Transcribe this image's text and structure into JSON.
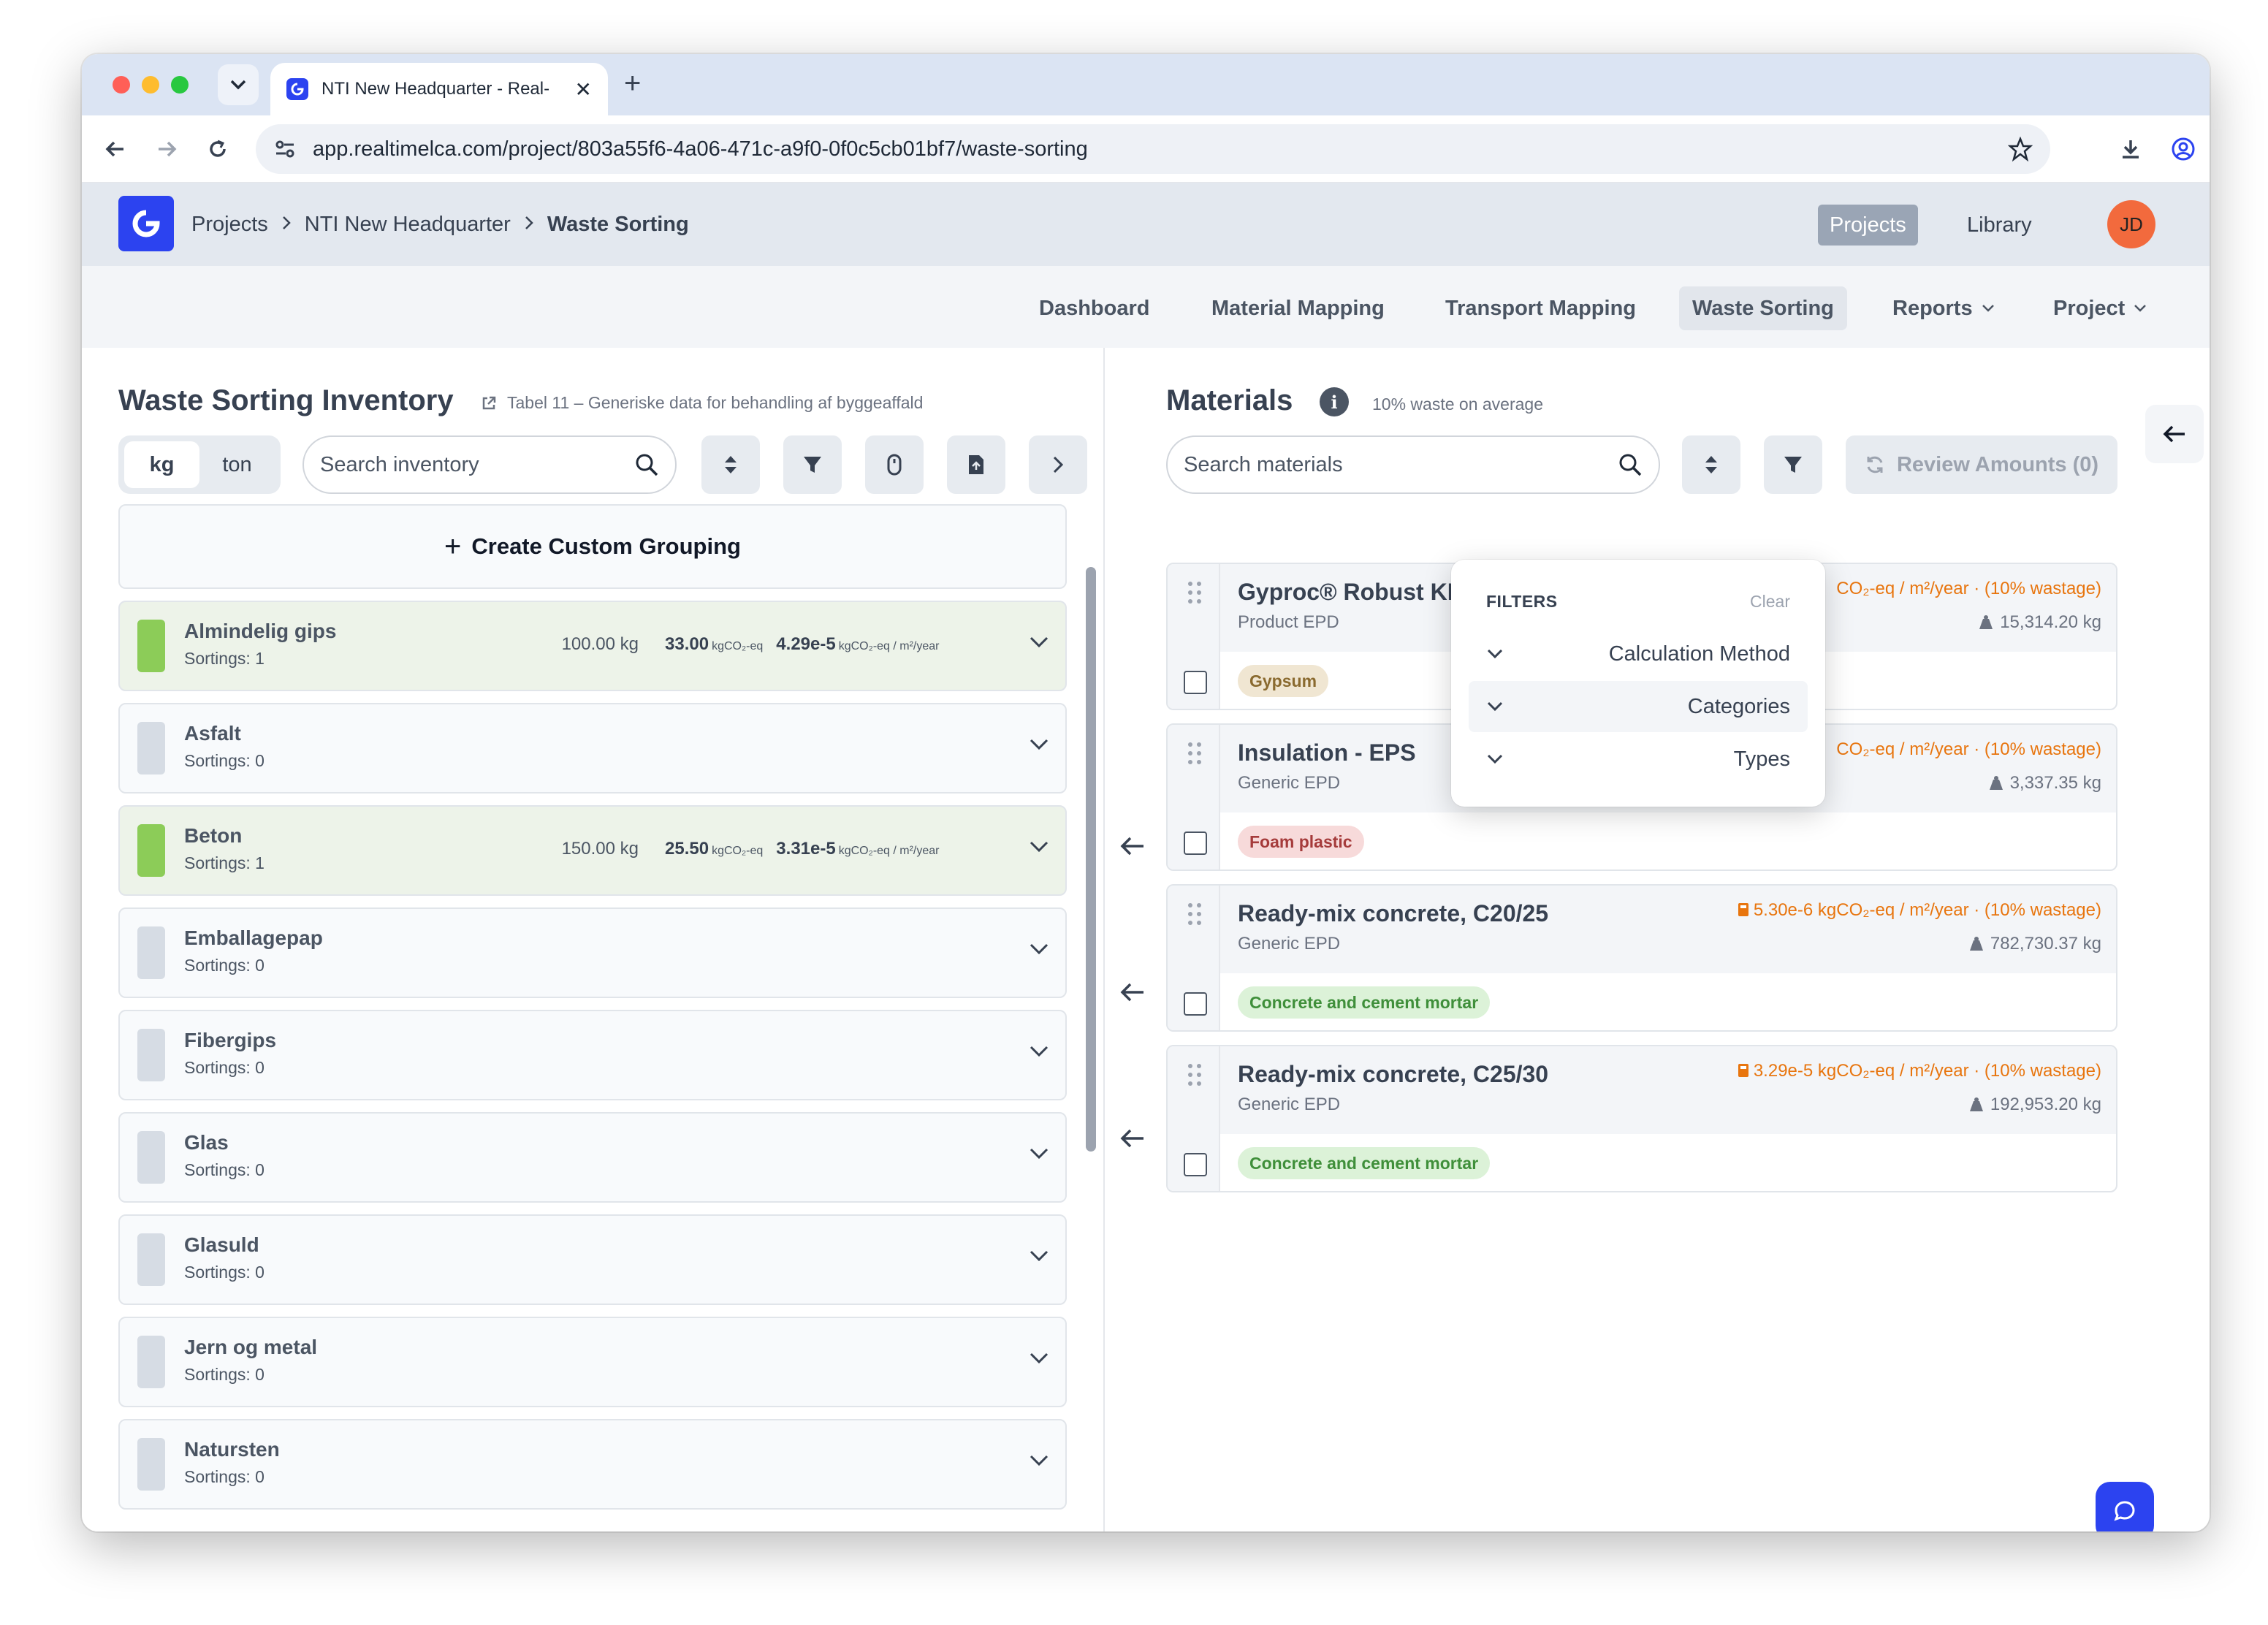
{
  "browser": {
    "tab_title": "NTI New Headquarter - Real-",
    "url": "app.realtimelca.com/project/803a55f6-4a06-471c-a9f0-0f0c5cb01bf7/waste-sorting",
    "colors": {
      "red": "#ff5f57",
      "yellow": "#febc2e",
      "green": "#28c840"
    }
  },
  "header": {
    "breadcrumb": [
      "Projects",
      "NTI New Headquarter",
      "Waste Sorting"
    ],
    "projects_btn": "Projects",
    "library_btn": "Library",
    "avatar_initials": "JD"
  },
  "subnav": {
    "items": [
      "Dashboard",
      "Material Mapping",
      "Transport Mapping",
      "Waste Sorting",
      "Reports",
      "Project"
    ],
    "active": "Waste Sorting"
  },
  "inventory": {
    "title": "Waste Sorting Inventory",
    "source_link": "Tabel 11 – Generiske data for behandling af byggeaffald",
    "unit_kg": "kg",
    "unit_ton": "ton",
    "search_placeholder": "Search inventory",
    "create_label": "Create Custom Grouping",
    "co2_unit": "kgCO₂-eq",
    "rate_unit": "kgCO₂-eq / m²/year",
    "groups": [
      {
        "name": "Almindelig gips",
        "sortings": "Sortings: 1",
        "filled": true,
        "weight": "100.00 kg",
        "co2": "33.00",
        "rate": "4.29e-5"
      },
      {
        "name": "Asfalt",
        "sortings": "Sortings: 0",
        "filled": false
      },
      {
        "name": "Beton",
        "sortings": "Sortings: 1",
        "filled": true,
        "weight": "150.00 kg",
        "co2": "25.50",
        "rate": "3.31e-5"
      },
      {
        "name": "Emballagepap",
        "sortings": "Sortings: 0",
        "filled": false
      },
      {
        "name": "Fibergips",
        "sortings": "Sortings: 0",
        "filled": false
      },
      {
        "name": "Glas",
        "sortings": "Sortings: 0",
        "filled": false
      },
      {
        "name": "Glasuld",
        "sortings": "Sortings: 0",
        "filled": false
      },
      {
        "name": "Jern og metal",
        "sortings": "Sortings: 0",
        "filled": false
      },
      {
        "name": "Natursten",
        "sortings": "Sortings: 0",
        "filled": false
      }
    ]
  },
  "materials": {
    "title": "Materials",
    "note": "10% waste on average",
    "search_placeholder": "Search materials",
    "review_label": "Review Amounts (0)",
    "items": [
      {
        "name": "Gyproc® Robust KI",
        "type": "Product EPD",
        "co2": "CO₂-eq / m²/year · (10% wastage)",
        "kg": "15,314.20 kg",
        "tag": "Gypsum",
        "tag_style": "gypsum"
      },
      {
        "name": "Insulation - EPS",
        "type": "Generic EPD",
        "co2": "CO₂-eq / m²/year · (10% wastage)",
        "kg": "3,337.35 kg",
        "tag": "Foam plastic",
        "tag_style": "foam"
      },
      {
        "name": "Ready-mix concrete, C20/25",
        "type": "Generic EPD",
        "co2": "5.30e-6 kgCO₂-eq / m²/year · (10% wastage)",
        "kg": "782,730.37 kg",
        "tag": "Concrete and cement mortar",
        "tag_style": "concrete"
      },
      {
        "name": "Ready-mix concrete, C25/30",
        "type": "Generic EPD",
        "co2": "3.29e-5 kgCO₂-eq / m²/year · (10% wastage)",
        "kg": "192,953.20 kg",
        "tag": "Concrete and cement mortar",
        "tag_style": "concrete"
      }
    ]
  },
  "filters": {
    "title": "FILTERS",
    "clear": "Clear",
    "options": [
      "Calculation Method",
      "Categories",
      "Types"
    ]
  }
}
